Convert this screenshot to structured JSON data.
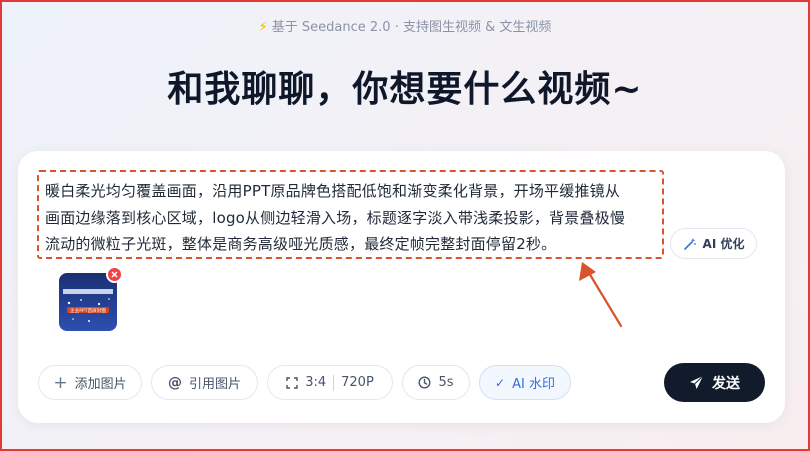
{
  "header": {
    "subtitle": "基于 Seedance 2.0 · 支持图生视频 & 文生视频",
    "title": "和我聊聊，你想要什么视频~"
  },
  "prompt": {
    "lines": [
      "暖白柔光均匀覆盖画面，沿用PPT原品牌色搭配低饱和渐变柔化背景，开场平缓推镜从",
      "画面边缘落到核心区域，logo从侧边轻滑入场，标题逐字淡入带浅柔投影，背景叠极慢",
      "流动的微粒子光斑，整体是商务高级哑光质感，最终定帧完整封面停留2秒。"
    ]
  },
  "ai_optimize": {
    "label": "AI 优化"
  },
  "attachment": {
    "thumb_caption": "企业PPT首屏封面"
  },
  "toolbar": {
    "add_image": "添加图片",
    "ref_image": "引用图片",
    "ratio": "3:4",
    "resolution": "720P",
    "duration": "5s",
    "watermark": "AI 水印"
  },
  "send": {
    "label": "发送"
  },
  "colors": {
    "accent_red": "#e53935",
    "send_bg": "#111b2b",
    "active_blue": "#2f6fe0"
  }
}
